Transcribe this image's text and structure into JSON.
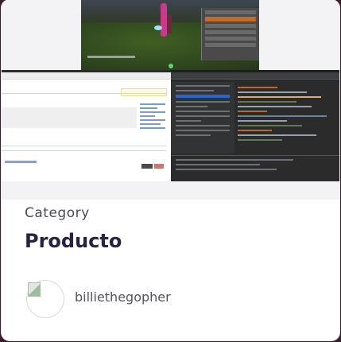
{
  "card": {
    "category_label": "Category",
    "title": "Producto",
    "author": {
      "name": "billiethegopher",
      "avatar_icon": "broken-image-icon"
    },
    "thumbnail": {
      "description_icon": "screenshot-collage-image"
    }
  },
  "colors": {
    "page_background": "#3a1e2b",
    "card_background": "#ffffff",
    "title_color": "#2a2240",
    "category_color": "#4a4a55"
  }
}
